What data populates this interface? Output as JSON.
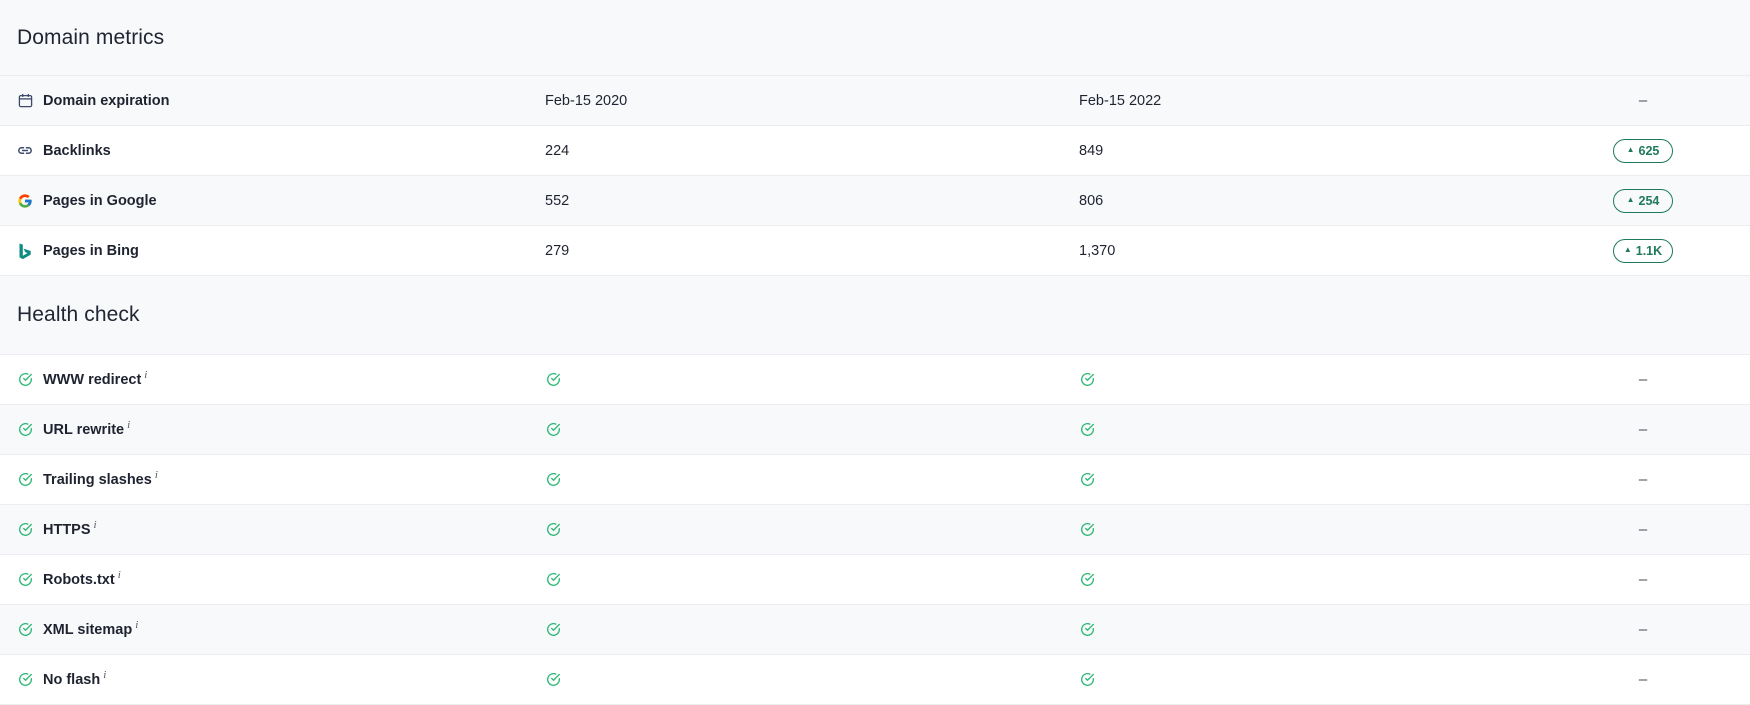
{
  "domain_metrics": {
    "title": "Domain metrics",
    "rows": [
      {
        "icon": "calendar-icon",
        "label": "Domain expiration",
        "value_a": "Feb-15 2020",
        "value_b": "Feb-15 2022",
        "change": "–"
      },
      {
        "icon": "link-icon",
        "label": "Backlinks",
        "value_a": "224",
        "value_b": "849",
        "change": "625",
        "change_direction": "up"
      },
      {
        "icon": "google-icon",
        "label": "Pages in Google",
        "value_a": "552",
        "value_b": "806",
        "change": "254",
        "change_direction": "up"
      },
      {
        "icon": "bing-icon",
        "label": "Pages in Bing",
        "value_a": "279",
        "value_b": "1,370",
        "change": "1.1K",
        "change_direction": "up"
      }
    ]
  },
  "health_check": {
    "title": "Health check",
    "info_marker": "i",
    "rows": [
      {
        "label": "WWW redirect",
        "status_a": "pass",
        "status_b": "pass",
        "change": "–"
      },
      {
        "label": "URL rewrite",
        "status_a": "pass",
        "status_b": "pass",
        "change": "–"
      },
      {
        "label": "Trailing slashes",
        "status_a": "pass",
        "status_b": "pass",
        "change": "–"
      },
      {
        "label": "HTTPS",
        "status_a": "pass",
        "status_b": "pass",
        "change": "–"
      },
      {
        "label": "Robots.txt",
        "status_a": "pass",
        "status_b": "pass",
        "change": "–"
      },
      {
        "label": "XML sitemap",
        "status_a": "pass",
        "status_b": "pass",
        "change": "–"
      },
      {
        "label": "No flash",
        "status_a": "pass",
        "status_b": "pass",
        "change": "–"
      }
    ]
  },
  "colors": {
    "positive": "#1f7a5a",
    "check": "#2bb673",
    "section_bg": "#f8f9fb"
  }
}
